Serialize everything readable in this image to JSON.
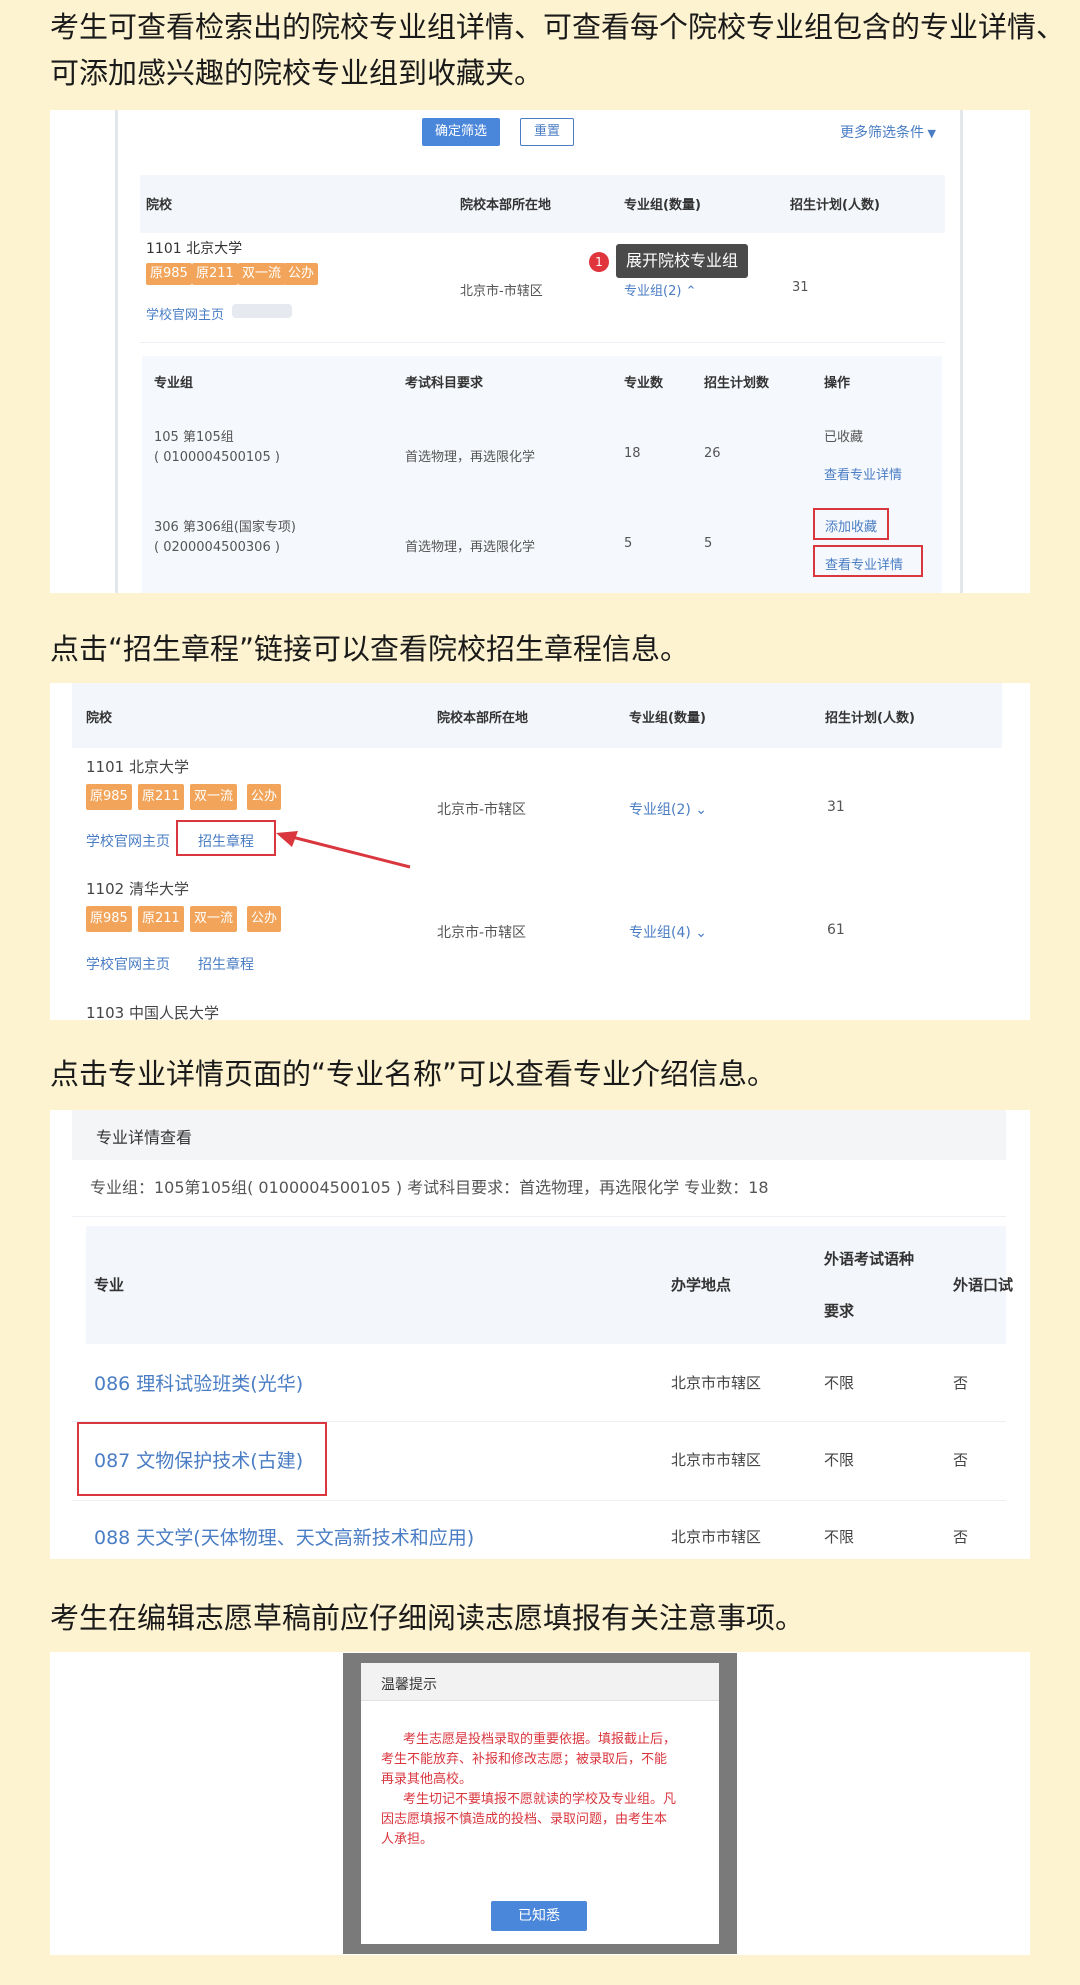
{
  "captions": {
    "c1_line1": "考生可查看检索出的院校专业组详情、可查看每个院校专业组包含的专业详情、",
    "c1_line2": "可添加感兴趣的院校专业组到收藏夹。",
    "c2": "点击“招生章程”链接可以查看院校招生章程信息。",
    "c3": "点击专业详情页面的“专业名称”可以查看专业介绍信息。",
    "c4": "考生在编辑志愿草稿前应仔细阅读志愿填报有关注意事项。"
  },
  "shot1": {
    "confirm_btn": "确定筛选",
    "reset_btn": "重置",
    "more_filters": "更多筛选条件",
    "headers": {
      "school": "院校",
      "location": "院校本部所在地",
      "groups": "专业组(数量)",
      "plan": "招生计划(人数)"
    },
    "school": {
      "name": "1101 北京大学",
      "tags": [
        "原985",
        "原211",
        "双一流",
        "公办"
      ],
      "homepage": "学校官网主页",
      "location": "北京市-市辖区",
      "groups": "专业组(2)",
      "plan": "31"
    },
    "tooltip": {
      "badge": "1",
      "text": "展开院校专业组"
    },
    "sub_headers": {
      "group": "专业组",
      "subjects": "考试科目要求",
      "count": "专业数",
      "plan": "招生计划数",
      "ops": "操作"
    },
    "rows": [
      {
        "name": "105 第105组",
        "code": "( 0100004500105 )",
        "subjects": "首选物理，再选限化学",
        "count": "18",
        "plan": "26",
        "op1": "已收藏",
        "op2": "查看专业详情"
      },
      {
        "name": "306 第306组(国家专项)",
        "code": "( 0200004500306 )",
        "subjects": "首选物理，再选限化学",
        "count": "5",
        "plan": "5",
        "op1": "添加收藏",
        "op2": "查看专业详情"
      }
    ]
  },
  "shot2": {
    "headers": {
      "school": "院校",
      "location": "院校本部所在地",
      "groups": "专业组(数量)",
      "plan": "招生计划(人数)"
    },
    "schools": [
      {
        "name": "1101 北京大学",
        "tags": [
          "原985",
          "原211",
          "双一流",
          "公办"
        ],
        "homepage": "学校官网主页",
        "charter": "招生章程",
        "location": "北京市-市辖区",
        "groups": "专业组(2)",
        "plan": "31"
      },
      {
        "name": "1102 清华大学",
        "tags": [
          "原985",
          "原211",
          "双一流",
          "公办"
        ],
        "homepage": "学校官网主页",
        "charter": "招生章程",
        "location": "北京市-市辖区",
        "groups": "专业组(4)",
        "plan": "61"
      }
    ],
    "next_school": "1103 中国人民大学"
  },
  "shot3": {
    "title": "专业详情查看",
    "info": "专业组：105第105组( 0100004500105 )  考试科目要求：首选物理，再选限化学  专业数：18",
    "headers": {
      "major": "专业",
      "place": "办学地点",
      "lang_line1": "外语考试语种",
      "lang_line2": "要求",
      "oral": "外语口试"
    },
    "rows": [
      {
        "major": "086 理科试验班类(光华)",
        "place": "北京市市辖区",
        "lang": "不限",
        "oral": "否"
      },
      {
        "major": "087 文物保护技术(古建)",
        "place": "北京市市辖区",
        "lang": "不限",
        "oral": "否"
      },
      {
        "major": "088 天文学(天体物理、天文高新技术和应用)",
        "place": "北京市市辖区",
        "lang": "不限",
        "oral": "否"
      }
    ]
  },
  "shot4": {
    "title": "温馨提示",
    "p1_l1": "考生志愿是投档录取的重要依据。填报截止后，",
    "p1_l2": "考生不能放弃、补报和修改志愿；被录取后，不能",
    "p1_l3": "再录其他高校。",
    "p2_l1": "考生切记不要填报不愿就读的学校及专业组。凡",
    "p2_l2": "因志愿填报不慎造成的投档、录取问题，由考生本",
    "p2_l3": "人承担。",
    "ok_btn": "已知悉"
  },
  "colors": {
    "background": "#fdf3d0",
    "tag": "#f2a55a",
    "link": "#4a7dc4",
    "highlight": "#d9363e",
    "primary": "#4a86d9"
  }
}
